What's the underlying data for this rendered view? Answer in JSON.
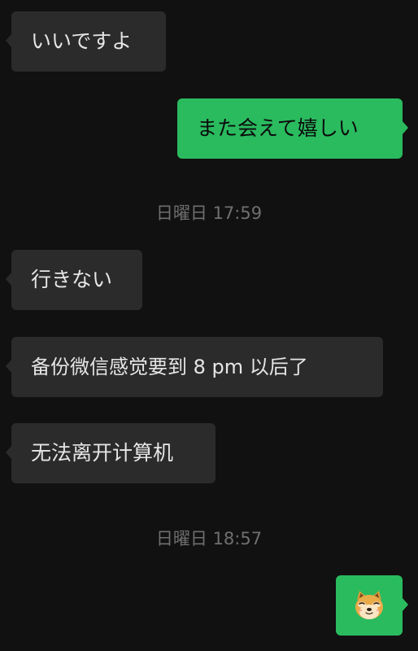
{
  "messages": [
    {
      "side": "in",
      "text": "いいですよ"
    },
    {
      "side": "out",
      "text": "また会えて嬉しい"
    },
    {
      "side": "in",
      "text": "行きない"
    },
    {
      "side": "in",
      "text": "备份微信感觉要到 8 pm 以后了"
    },
    {
      "side": "in",
      "text": "无法离开计算机"
    },
    {
      "side": "out",
      "sticker": "doge-emoji-icon"
    }
  ],
  "timestamps": [
    "日曜日 17:59",
    "日曜日 18:57"
  ],
  "colors": {
    "background": "#111111",
    "incoming_bubble": "#2b2b2b",
    "outgoing_bubble": "#2abb5f",
    "timestamp_text": "#6f6f6f"
  }
}
